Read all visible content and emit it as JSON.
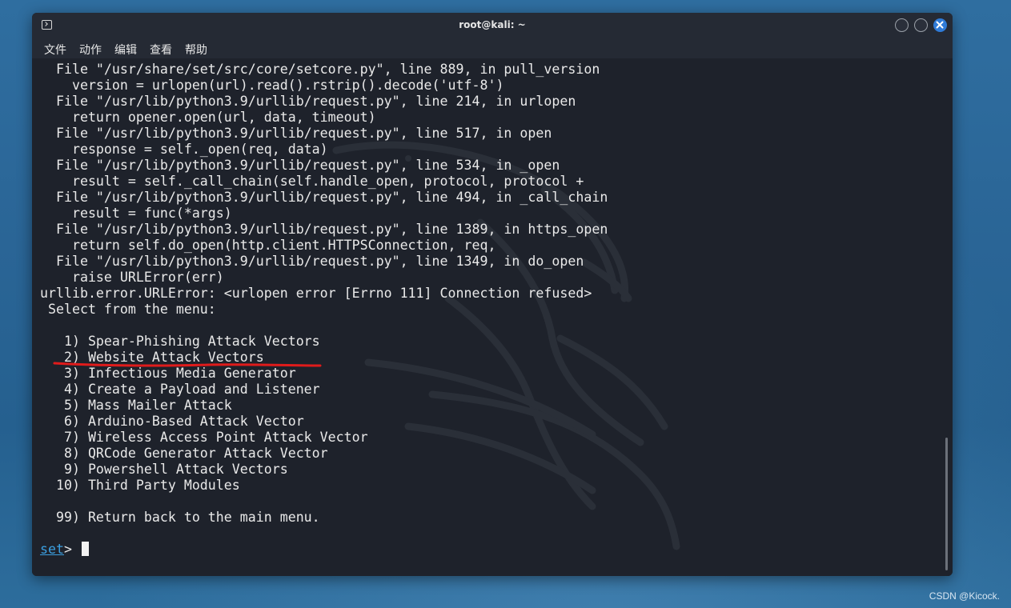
{
  "window": {
    "title": "root@kali: ~"
  },
  "menu": {
    "items": [
      "文件",
      "动作",
      "编辑",
      "查看",
      "帮助"
    ]
  },
  "terminal": {
    "lines": [
      "  File \"/usr/share/set/src/core/setcore.py\", line 889, in pull_version",
      "    version = urlopen(url).read().rstrip().decode('utf-8')",
      "  File \"/usr/lib/python3.9/urllib/request.py\", line 214, in urlopen",
      "    return opener.open(url, data, timeout)",
      "  File \"/usr/lib/python3.9/urllib/request.py\", line 517, in open",
      "    response = self._open(req, data)",
      "  File \"/usr/lib/python3.9/urllib/request.py\", line 534, in _open",
      "    result = self._call_chain(self.handle_open, protocol, protocol +",
      "  File \"/usr/lib/python3.9/urllib/request.py\", line 494, in _call_chain",
      "    result = func(*args)",
      "  File \"/usr/lib/python3.9/urllib/request.py\", line 1389, in https_open",
      "    return self.do_open(http.client.HTTPSConnection, req,",
      "  File \"/usr/lib/python3.9/urllib/request.py\", line 1349, in do_open",
      "    raise URLError(err)",
      "urllib.error.URLError: <urlopen error [Errno 111] Connection refused>",
      " Select from the menu:",
      "",
      "   1) Spear-Phishing Attack Vectors",
      "   2) Website Attack Vectors",
      "   3) Infectious Media Generator",
      "   4) Create a Payload and Listener",
      "   5) Mass Mailer Attack",
      "   6) Arduino-Based Attack Vector",
      "   7) Wireless Access Point Attack Vector",
      "   8) QRCode Generator Attack Vector",
      "   9) Powershell Attack Vectors",
      "  10) Third Party Modules",
      "",
      "  99) Return back to the main menu.",
      ""
    ],
    "prompt_name": "set",
    "prompt_suffix": "> "
  },
  "colors": {
    "terminal_bg": "#1e222b",
    "prompt": "#3b9fe0",
    "annotation": "#e01b1b",
    "close_button": "#2f7bd8"
  },
  "watermark": "CSDN @Kicock."
}
